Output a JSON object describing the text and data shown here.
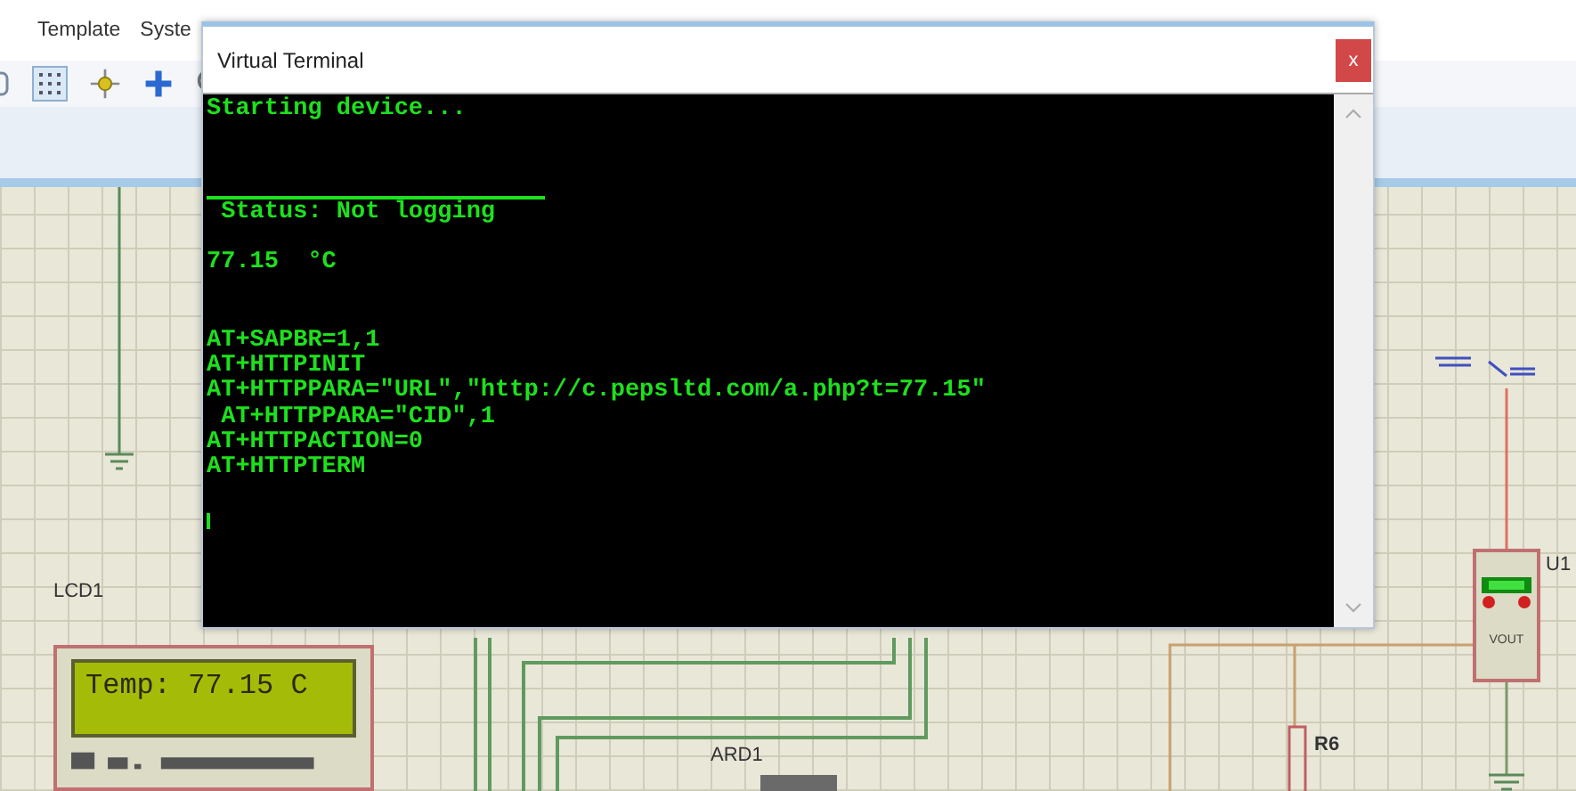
{
  "menu": [
    {
      "label": "Template"
    },
    {
      "label": "Syste"
    }
  ],
  "terminal": {
    "title": "Virtual Terminal",
    "close": "x",
    "lines": [
      {
        "kind": "text",
        "text": "Starting device..."
      },
      {
        "kind": "blank"
      },
      {
        "kind": "blank"
      },
      {
        "kind": "rule"
      },
      {
        "kind": "text",
        "text": " Status: Not logging"
      },
      {
        "kind": "blank"
      },
      {
        "kind": "text",
        "text": "77.15  °C"
      },
      {
        "kind": "blank"
      },
      {
        "kind": "blank"
      },
      {
        "kind": "text",
        "text": "AT+SAPBR=1,1"
      },
      {
        "kind": "text",
        "text": "AT+HTTPINIT"
      },
      {
        "kind": "text",
        "text": "AT+HTTPPARA=\"URL\",\"http://c.pepsltd.com/a.php?t=77.15\""
      },
      {
        "kind": "text",
        "text": " AT+HTTPPARA=\"CID\",1"
      },
      {
        "kind": "text",
        "text": "AT+HTTPACTION=0"
      },
      {
        "kind": "text",
        "text": "AT+HTTPTERM"
      },
      {
        "kind": "blank"
      },
      {
        "kind": "cursor"
      }
    ]
  },
  "schematic": {
    "lcd": {
      "ref": "LCD1",
      "display": "Temp: 77.15 C"
    },
    "arduino": {
      "ref": "ARD1"
    },
    "resistor": {
      "ref": "R6"
    },
    "sensor": {
      "ref": "U1",
      "pin_label": "VOUT"
    }
  }
}
